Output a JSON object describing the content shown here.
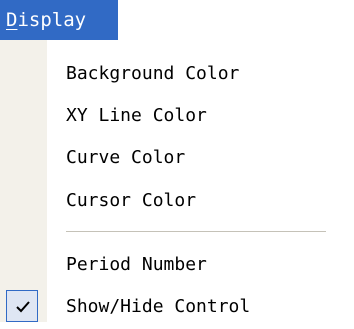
{
  "menu": {
    "title_accel": "D",
    "title_rest": "isplay"
  },
  "items": [
    {
      "label": "Background Color",
      "checked": false
    },
    {
      "label": "XY Line Color",
      "checked": false
    },
    {
      "label": "Curve Color",
      "checked": false
    },
    {
      "label": "Cursor Color",
      "checked": false
    },
    {
      "label": "Period Number",
      "checked": false
    },
    {
      "label": "Show/Hide Control",
      "checked": true
    }
  ],
  "colors": {
    "menu_highlight": "#316ac5",
    "gutter": "#f3f1ea",
    "check_bg": "#dfe6f3"
  },
  "icons": {
    "check": "check-icon"
  }
}
